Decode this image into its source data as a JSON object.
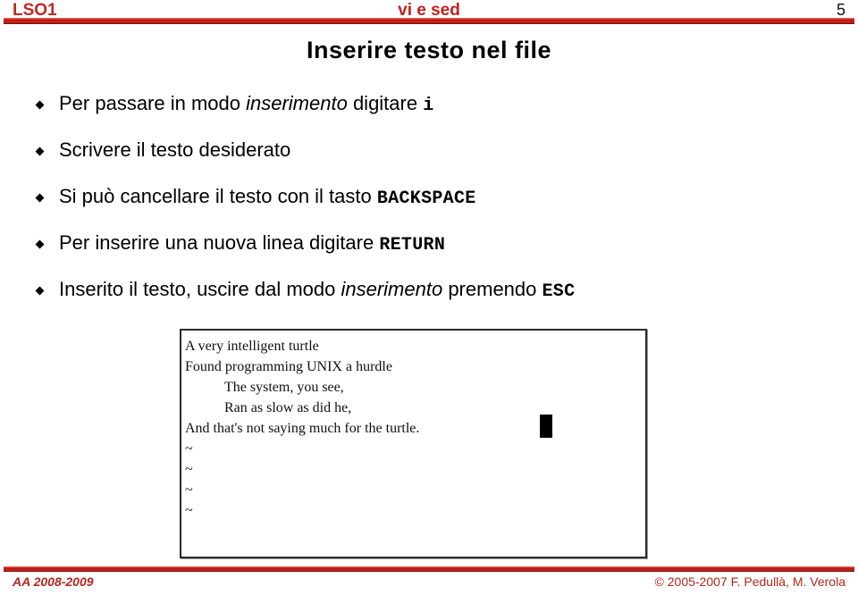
{
  "header": {
    "course_label": "LSO1",
    "title": "vi e sed",
    "page_number": "5"
  },
  "slide": {
    "title": "Inserire testo nel file",
    "bullets": [
      {
        "parts": [
          {
            "text": "Per passare in modo ",
            "style": "normal"
          },
          {
            "text": "inserimento",
            "style": "italic"
          },
          {
            "text": " digitare ",
            "style": "normal"
          },
          {
            "text": "i",
            "style": "mono"
          }
        ]
      },
      {
        "parts": [
          {
            "text": "Scrivere il testo desiderato",
            "style": "normal"
          }
        ]
      },
      {
        "parts": [
          {
            "text": "Si può cancellare il testo con il tasto ",
            "style": "normal"
          },
          {
            "text": "BACKSPACE",
            "style": "mono"
          }
        ]
      },
      {
        "parts": [
          {
            "text": "Per inserire una nuova linea digitare ",
            "style": "normal"
          },
          {
            "text": "RETURN",
            "style": "mono"
          }
        ]
      },
      {
        "parts": [
          {
            "text": "Inserito il testo, uscire dal modo ",
            "style": "normal"
          },
          {
            "text": "inserimento",
            "style": "italic"
          },
          {
            "text": " premendo ",
            "style": "normal"
          },
          {
            "text": "ESC",
            "style": "mono"
          }
        ]
      }
    ]
  },
  "terminal": {
    "lines": [
      {
        "text": "A very intelligent turtle",
        "indent": false
      },
      {
        "text": "Found programming UNIX a hurdle",
        "indent": false
      },
      {
        "text": "The system, you see,",
        "indent": true
      },
      {
        "text": "Ran as slow as did he,",
        "indent": true
      },
      {
        "text": "And that's not saying much for the turtle.",
        "indent": false
      }
    ],
    "tildes": [
      "~",
      "~",
      "~",
      "~"
    ],
    "cursor": "block"
  },
  "footer": {
    "academic_year": "AA 2008-2009",
    "copyright": "© 2005-2007 F. Pedullà, M. Verola"
  },
  "colors": {
    "accent_red": "#BE2A22",
    "rule_red": "#C0211B",
    "footer_red": "#B4261D",
    "text_black": "#000000",
    "background": "#FFFFFF"
  }
}
